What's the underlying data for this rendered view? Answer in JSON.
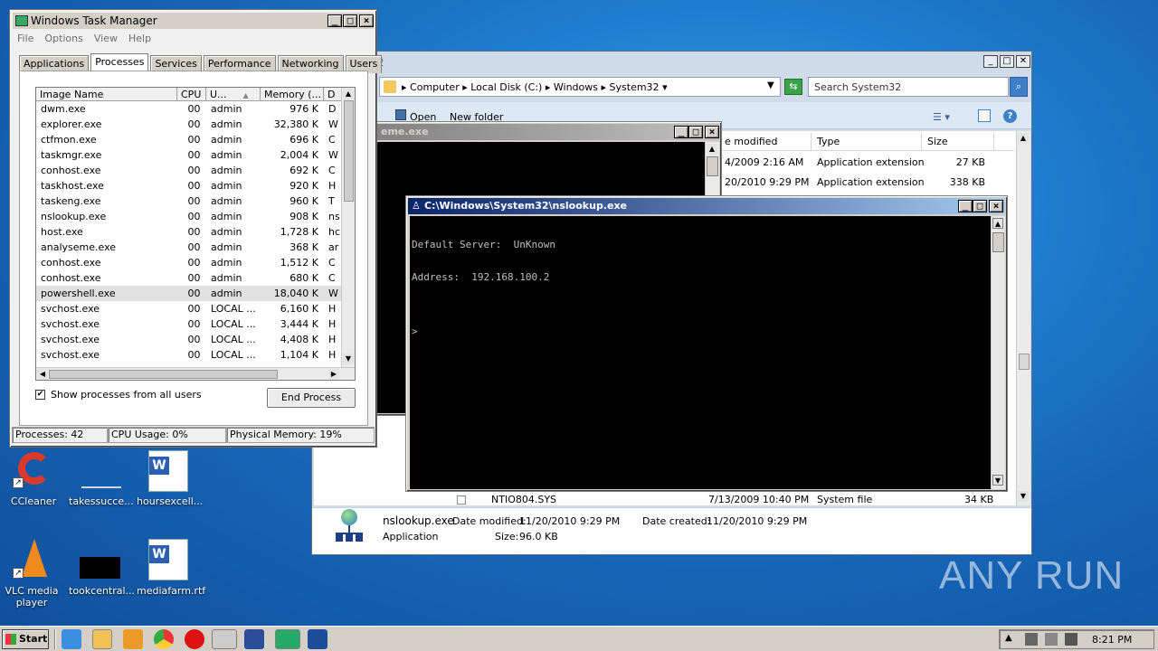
{
  "task_manager": {
    "title": "Windows Task Manager",
    "menu": [
      "File",
      "Options",
      "View",
      "Help"
    ],
    "tabs": [
      {
        "label": "Applications"
      },
      {
        "label": "Processes",
        "selected": true
      },
      {
        "label": "Services"
      },
      {
        "label": "Performance"
      },
      {
        "label": "Networking"
      },
      {
        "label": "Users"
      }
    ],
    "columns": [
      "Image Name",
      "CPU",
      "U...",
      "Memory (...",
      "D"
    ],
    "rows": [
      {
        "name": "dwm.exe",
        "cpu": "00",
        "user": "admin",
        "mem": "976 K",
        "d": "D"
      },
      {
        "name": "explorer.exe",
        "cpu": "00",
        "user": "admin",
        "mem": "32,380 K",
        "d": "W"
      },
      {
        "name": "ctfmon.exe",
        "cpu": "00",
        "user": "admin",
        "mem": "696 K",
        "d": "C"
      },
      {
        "name": "taskmgr.exe",
        "cpu": "00",
        "user": "admin",
        "mem": "2,004 K",
        "d": "W"
      },
      {
        "name": "conhost.exe",
        "cpu": "00",
        "user": "admin",
        "mem": "692 K",
        "d": "C"
      },
      {
        "name": "taskhost.exe",
        "cpu": "00",
        "user": "admin",
        "mem": "920 K",
        "d": "H"
      },
      {
        "name": "taskeng.exe",
        "cpu": "00",
        "user": "admin",
        "mem": "960 K",
        "d": "T"
      },
      {
        "name": "nslookup.exe",
        "cpu": "00",
        "user": "admin",
        "mem": "908 K",
        "d": "ns"
      },
      {
        "name": "host.exe",
        "cpu": "00",
        "user": "admin",
        "mem": "1,728 K",
        "d": "hc"
      },
      {
        "name": "analyseme.exe",
        "cpu": "00",
        "user": "admin",
        "mem": "368 K",
        "d": "ar"
      },
      {
        "name": "conhost.exe",
        "cpu": "00",
        "user": "admin",
        "mem": "1,512 K",
        "d": "C"
      },
      {
        "name": "conhost.exe",
        "cpu": "00",
        "user": "admin",
        "mem": "680 K",
        "d": "C"
      },
      {
        "name": "powershell.exe",
        "cpu": "00",
        "user": "admin",
        "mem": "18,040 K",
        "d": "W",
        "selected": true
      },
      {
        "name": "svchost.exe",
        "cpu": "00",
        "user": "LOCAL ...",
        "mem": "6,160 K",
        "d": "H"
      },
      {
        "name": "svchost.exe",
        "cpu": "00",
        "user": "LOCAL ...",
        "mem": "3,444 K",
        "d": "H"
      },
      {
        "name": "svchost.exe",
        "cpu": "00",
        "user": "LOCAL ...",
        "mem": "4,408 K",
        "d": "H"
      },
      {
        "name": "svchost.exe",
        "cpu": "00",
        "user": "LOCAL ...",
        "mem": "1,104 K",
        "d": "H"
      }
    ],
    "show_all_label": "Show processes from all users",
    "show_all_checked": true,
    "end_process_label": "End Process",
    "status_processes": "Processes: 42",
    "status_cpu": "CPU Usage: 0%",
    "status_memory": "Physical Memory: 19%"
  },
  "explorer": {
    "title_fragment": "2",
    "breadcrumb": [
      "Computer",
      "Local Disk (C:)",
      "Windows",
      "System32"
    ],
    "search_placeholder": "Search System32",
    "toolbar": {
      "open": "Open",
      "new_folder": "New folder"
    },
    "columns": [
      "e modified",
      "Type",
      "Size"
    ],
    "rows": [
      {
        "modified": "4/2009 2:16 AM",
        "type": "Application extension",
        "size": "27 KB"
      },
      {
        "modified": "20/2010 9:29 PM",
        "type": "Application extension",
        "size": "338 KB"
      }
    ],
    "bottom_row": {
      "name": "NTIO804.SYS",
      "modified": "7/13/2009 10:40 PM",
      "type": "System file",
      "size": "34 KB"
    },
    "details": {
      "name": "nslookup.exe",
      "date_modified_label": "Date modified:",
      "date_modified": "11/20/2010 9:29 PM",
      "date_created_label": "Date created:",
      "date_created": "11/20/2010 9:29 PM",
      "type": "Application",
      "size_label": "Size:",
      "size": "96.0 KB"
    }
  },
  "analyse_console": {
    "title_fragment": "eme.exe"
  },
  "nslookup_console": {
    "title": "C:\\Windows\\System32\\nslookup.exe",
    "lines": [
      "Default Server:  UnKnown",
      "Address:  192.168.100.2",
      "",
      ">"
    ]
  },
  "desktop_icons": [
    {
      "label": "CCleaner"
    },
    {
      "label": "takessucce..."
    },
    {
      "label": "hoursexcell..."
    },
    {
      "label": "VLC media player"
    },
    {
      "label": "tookcentral..."
    },
    {
      "label": "mediafarm.rtf"
    }
  ],
  "taskbar": {
    "start_label": "Start",
    "clock": "8:21 PM"
  },
  "watermark": "ANY RUN",
  "colors": {
    "accent": "#0a246a",
    "desktop": "#1764b6",
    "selection": "#e1e1e1"
  }
}
